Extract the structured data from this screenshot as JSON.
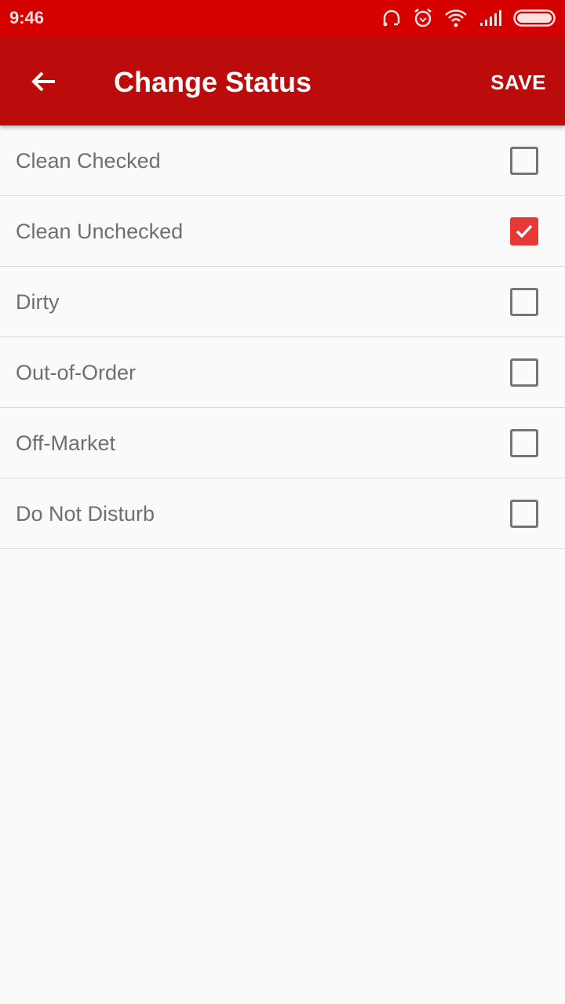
{
  "status_bar": {
    "time": "9:46",
    "icons": [
      "headphones-icon",
      "alarm-icon",
      "wifi-icon",
      "signal-icon",
      "battery-icon"
    ]
  },
  "app_bar": {
    "title": "Change Status",
    "save_label": "SAVE",
    "back_icon": "arrow-left-icon"
  },
  "statuses": [
    {
      "label": "Clean Checked",
      "checked": false
    },
    {
      "label": "Clean Unchecked",
      "checked": true
    },
    {
      "label": "Dirty",
      "checked": false
    },
    {
      "label": "Out-of-Order",
      "checked": false
    },
    {
      "label": "Off-Market",
      "checked": false
    },
    {
      "label": "Do Not Disturb",
      "checked": false
    }
  ],
  "colors": {
    "status_bar": "#d50000",
    "app_bar": "#bb0b0b",
    "accent": "#e53935"
  }
}
